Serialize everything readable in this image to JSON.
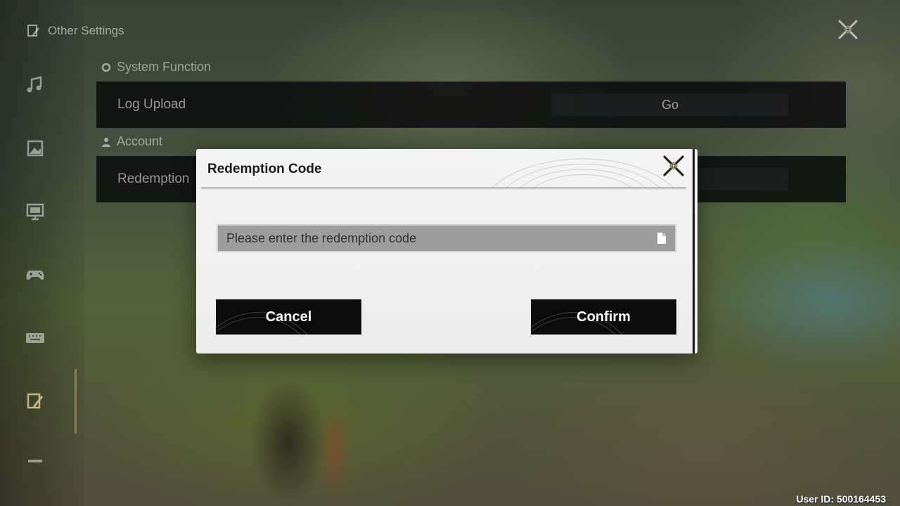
{
  "header": {
    "title": "Other Settings",
    "icon": "settings-tools-icon",
    "close_icon": "close-x-icon"
  },
  "sidebar": {
    "items": [
      {
        "name": "music-icon",
        "active": false
      },
      {
        "name": "picture-icon",
        "active": false
      },
      {
        "name": "display-icon",
        "active": false
      },
      {
        "name": "controller-icon",
        "active": false
      },
      {
        "name": "keyboard-icon",
        "active": false
      },
      {
        "name": "settings-tools-icon",
        "active": true
      },
      {
        "name": "minus-icon",
        "active": false
      }
    ]
  },
  "sections": {
    "system": {
      "label": "System Function",
      "icon": "gear-icon",
      "rows": [
        {
          "label": "Log Upload",
          "action": "Go"
        }
      ]
    },
    "account": {
      "label": "Account",
      "icon": "user-icon",
      "rows": [
        {
          "label": "Redemption",
          "action": ""
        }
      ]
    }
  },
  "dialog": {
    "title": "Redemption Code",
    "input": {
      "placeholder": "Please enter the redemption code",
      "value": "",
      "icon": "paste-icon"
    },
    "cancel_label": "Cancel",
    "confirm_label": "Confirm"
  },
  "footer": {
    "user_id": "User ID: 500164453"
  },
  "colors": {
    "dialog_bg": "#f0f0f0",
    "button_bg": "#0b0b0b",
    "input_bg": "#9d9d9d",
    "accent_gold": "#c8b482"
  }
}
